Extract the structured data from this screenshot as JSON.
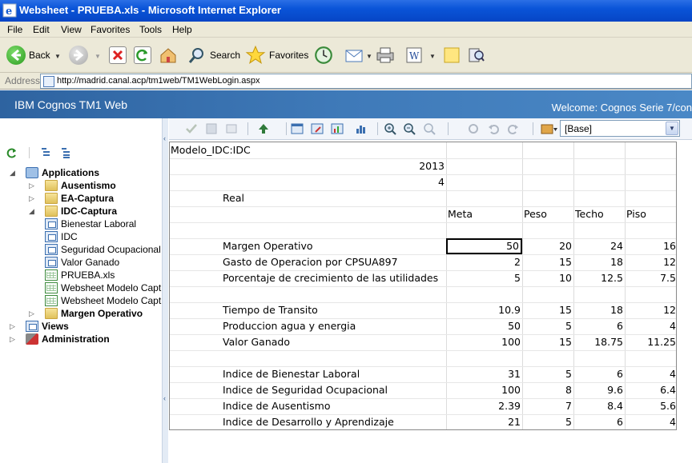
{
  "window": {
    "title": "Websheet - PRUEBA.xls - Microsoft Internet Explorer"
  },
  "menu": [
    "File",
    "Edit",
    "View",
    "Favorites",
    "Tools",
    "Help"
  ],
  "toolbar": {
    "back_label": "Back",
    "search_label": "Search",
    "favorites_label": "Favorites"
  },
  "address": {
    "label": "Address",
    "url": "http://madrid.canal.acp/tm1web/TM1WebLogin.aspx"
  },
  "header": {
    "app_title": "IBM Cognos TM1 Web",
    "welcome": "Welcome: Cognos Serie 7/con"
  },
  "subset": {
    "selected": "[Base]"
  },
  "tree": {
    "applications": "Applications",
    "ausentismo": "Ausentismo",
    "ea_captura": "EA-Captura",
    "idc_captura": "IDC-Captura",
    "items": [
      "Bienestar Laboral",
      "IDC",
      "Seguridad Ocupacional",
      "Valor Ganado",
      "PRUEBA.xls",
      "Websheet Modelo Capt",
      "Websheet Modelo Capt"
    ],
    "margen_operativo": "Margen Operativo",
    "views": "Views",
    "administration": "Administration"
  },
  "sheet": {
    "cube_title": "Modelo_IDC:IDC",
    "year": "2013",
    "period": "4",
    "scenario": "Real",
    "columns": [
      "Meta",
      "Peso",
      "Techo",
      "Piso"
    ],
    "rows": [
      {
        "label": "Margen Operativo",
        "values": [
          "50",
          "20",
          "24",
          "16"
        ]
      },
      {
        "label": "Gasto de Operacion por CPSUA897",
        "values": [
          "2",
          "15",
          "18",
          "12"
        ]
      },
      {
        "label": "Porcentaje de crecimiento de las utilidades",
        "values": [
          "5",
          "10",
          "12.5",
          "7.5"
        ]
      },
      {
        "label": "Tiempo de Transito",
        "values": [
          "10.9",
          "15",
          "18",
          "12"
        ]
      },
      {
        "label": "Produccion agua y energia",
        "values": [
          "50",
          "5",
          "6",
          "4"
        ]
      },
      {
        "label": "Valor Ganado",
        "values": [
          "100",
          "15",
          "18.75",
          "11.25"
        ]
      },
      {
        "label": "Indice de Bienestar Laboral",
        "values": [
          "31",
          "5",
          "6",
          "4"
        ]
      },
      {
        "label": "Indice de Seguridad Ocupacional",
        "values": [
          "100",
          "8",
          "9.6",
          "6.4"
        ]
      },
      {
        "label": "Indice de Ausentismo",
        "values": [
          "2.39",
          "7",
          "8.4",
          "5.6"
        ]
      },
      {
        "label": "Indice de Desarrollo y Aprendizaje",
        "values": [
          "21",
          "5",
          "6",
          "4"
        ]
      }
    ]
  },
  "icons": {
    "title": "ie-icon",
    "back": "back-arrow-icon",
    "forward": "forward-arrow-icon",
    "stop": "stop-icon",
    "refresh": "refresh-icon",
    "home": "home-icon",
    "search": "search-icon",
    "favorites": "star-icon",
    "history": "history-icon",
    "mail": "mail-icon",
    "print": "printer-icon",
    "edit": "word-edit-icon",
    "notes": "note-icon",
    "research": "research-icon"
  }
}
